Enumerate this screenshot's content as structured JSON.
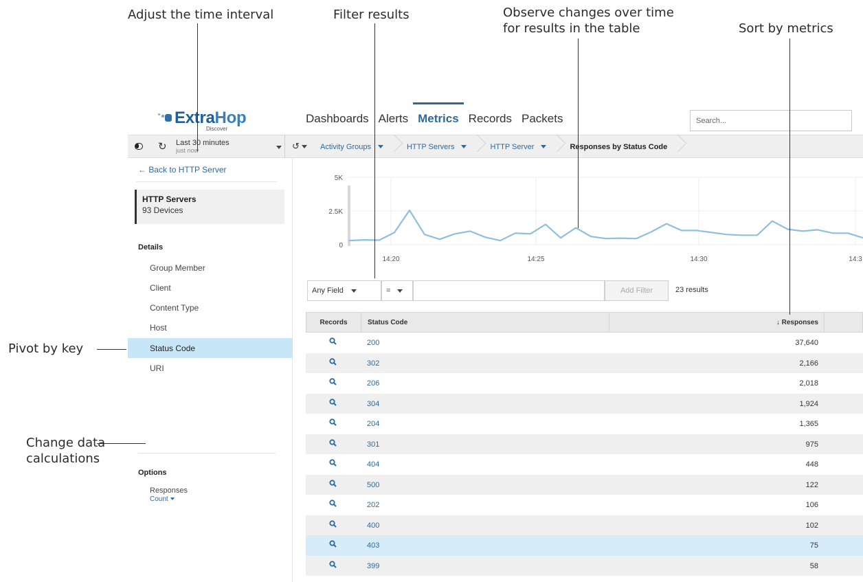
{
  "callouts": {
    "time": "Adjust the time interval",
    "filter": "Filter results",
    "observe_1": "Observe changes over time",
    "observe_2": "for results in the table",
    "sort": "Sort by metrics",
    "pivot": "Pivot by key",
    "change_1": "Change data",
    "change_2": "calculations"
  },
  "logo": {
    "word_a": "Extra",
    "word_b": "Hop",
    "sub": "Discover"
  },
  "nav": {
    "items": [
      "Dashboards",
      "Alerts",
      "Metrics",
      "Records",
      "Packets"
    ],
    "active": "Metrics"
  },
  "search": {
    "placeholder": "Search..."
  },
  "timebar": {
    "range": "Last 30 minutes",
    "until": "just now"
  },
  "breadcrumbs": [
    "Activity Groups",
    "HTTP Servers",
    "HTTP Server",
    "Responses by Status Code"
  ],
  "sidebar": {
    "back": "Back to HTTP Server",
    "group_title": "HTTP Servers",
    "group_count": "93 Devices",
    "details_title": "Details",
    "details": [
      "Group Member",
      "Client",
      "Content Type",
      "Host",
      "Status Code",
      "URI"
    ],
    "selected": "Status Code",
    "options_title": "Options",
    "option_label": "Responses",
    "option_value": "Count"
  },
  "chart_data": {
    "type": "line",
    "y_ticks": [
      "5K",
      "2.5K",
      "0"
    ],
    "x_ticks": [
      "14:20",
      "14:25",
      "14:30",
      "14:3"
    ],
    "ylim": [
      0,
      5000
    ],
    "series": [
      {
        "values": [
          300,
          350,
          330,
          900,
          2550,
          750,
          400,
          800,
          1000,
          550,
          300,
          850,
          800,
          1500,
          500,
          1250,
          600,
          450,
          480,
          450,
          950,
          1550,
          1050,
          1050,
          900,
          750,
          700,
          700,
          1750,
          1150,
          1000,
          1100,
          850,
          850,
          500
        ]
      }
    ],
    "grid": true,
    "color": "#8fbfdb"
  },
  "filter": {
    "field": "Any Field",
    "operator": "=",
    "add_label": "Add Filter",
    "results": "23 results"
  },
  "table": {
    "headers": [
      "Records",
      "Status Code",
      "↓ Responses"
    ],
    "rows": [
      {
        "code": "200",
        "value": "37,640"
      },
      {
        "code": "302",
        "value": "2,166"
      },
      {
        "code": "206",
        "value": "2,018"
      },
      {
        "code": "304",
        "value": "1,924"
      },
      {
        "code": "204",
        "value": "1,365"
      },
      {
        "code": "301",
        "value": "975"
      },
      {
        "code": "404",
        "value": "448"
      },
      {
        "code": "500",
        "value": "122"
      },
      {
        "code": "202",
        "value": "106"
      },
      {
        "code": "400",
        "value": "102"
      },
      {
        "code": "403",
        "value": "75"
      },
      {
        "code": "399",
        "value": "58"
      }
    ],
    "highlighted_code": "403"
  }
}
